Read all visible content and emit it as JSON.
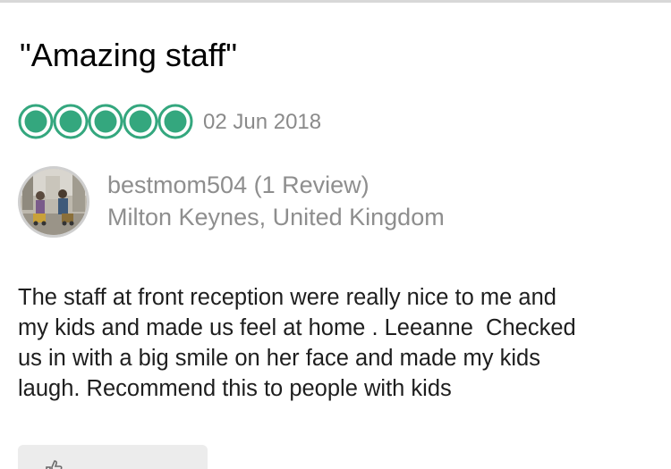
{
  "review": {
    "title": "\"Amazing staff\"",
    "rating": 5,
    "rating_max": 5,
    "date": "02 Jun 2018",
    "rating_color": "#34a77e",
    "body_lines": [
      "The staff at front reception were really nice to me and",
      "my kids and made us feel at home . Leeanne  Checked",
      "us in with a big smile on her face and made my kids",
      "laugh. Recommend this to people with kids"
    ]
  },
  "reviewer": {
    "username_line": "bestmom504 (1 Review)",
    "location": "Milton Keynes, United Kingdom",
    "avatar_icon": "user-photo-avatar"
  },
  "actions": {
    "helpful_icon": "thumbs-up-icon"
  }
}
